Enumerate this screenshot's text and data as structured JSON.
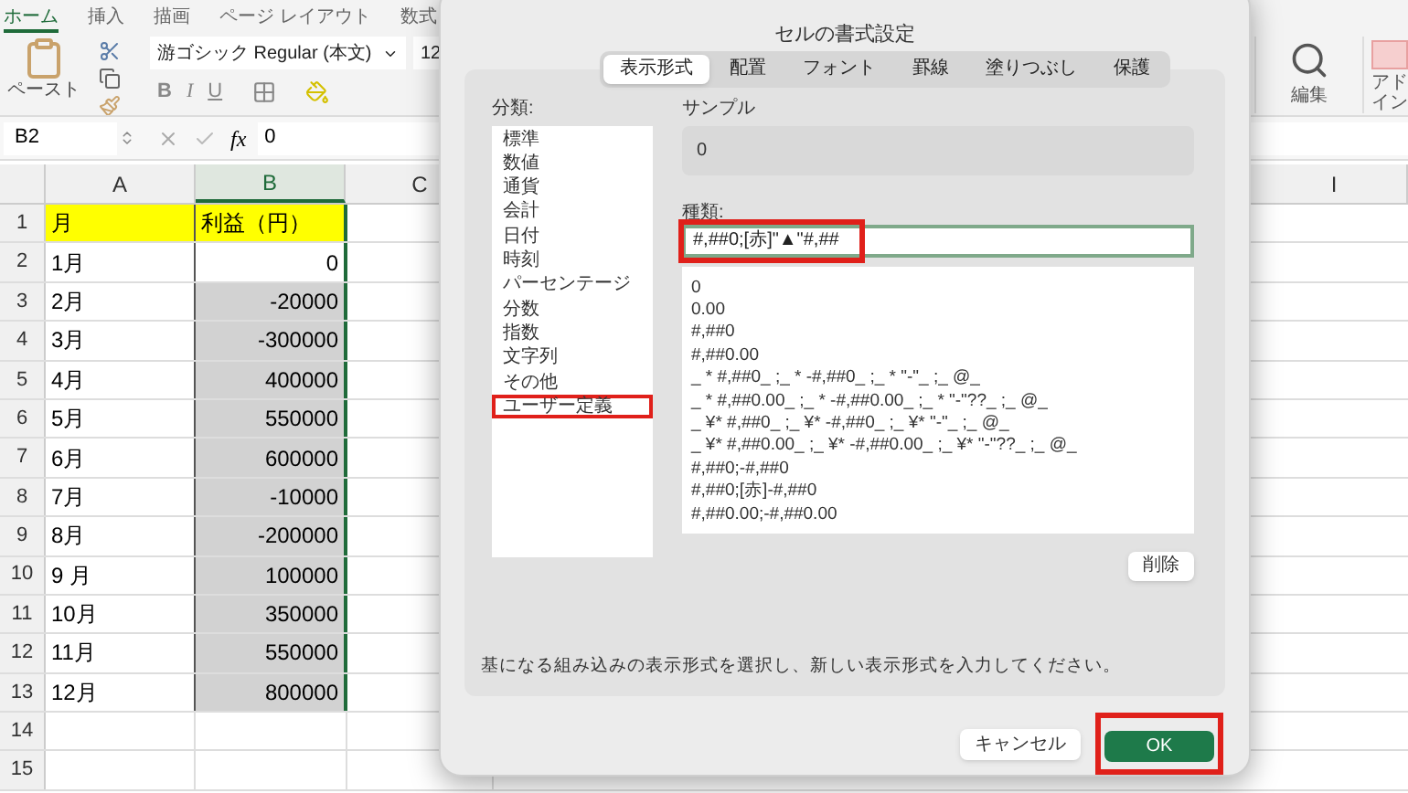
{
  "ribbon_tabs": [
    {
      "label": "ホーム",
      "selected": true
    },
    {
      "label": "挿入",
      "selected": false
    },
    {
      "label": "描画",
      "selected": false
    },
    {
      "label": "ページ レイアウト",
      "selected": false
    },
    {
      "label": "数式",
      "selected": false
    }
  ],
  "ribbon": {
    "paste_label": "ペースト",
    "font_name": "游ゴシック Regular (本文)",
    "font_size": "12",
    "bold": "B",
    "italic": "I",
    "underline": "U",
    "edit_label": "編集",
    "addin_label": "アドイン"
  },
  "formula_bar": {
    "cell_ref": "B2",
    "fx": "fx",
    "value": "0"
  },
  "sheet": {
    "columns": [
      "A",
      "B",
      "C",
      "I"
    ],
    "rows": [
      {
        "number": "1",
        "a": "月",
        "b": "利益（円）",
        "header": true
      },
      {
        "number": "2",
        "a": "1月",
        "b": "0",
        "header": false,
        "shaded": false
      },
      {
        "number": "3",
        "a": "2月",
        "b": "-20000",
        "header": false,
        "shaded": true
      },
      {
        "number": "4",
        "a": "3月",
        "b": "-300000",
        "header": false,
        "shaded": true
      },
      {
        "number": "5",
        "a": "4月",
        "b": "400000",
        "header": false,
        "shaded": true
      },
      {
        "number": "6",
        "a": "5月",
        "b": "550000",
        "header": false,
        "shaded": true
      },
      {
        "number": "7",
        "a": "6月",
        "b": "600000",
        "header": false,
        "shaded": true
      },
      {
        "number": "8",
        "a": "7月",
        "b": "-10000",
        "header": false,
        "shaded": true
      },
      {
        "number": "9",
        "a": "8月",
        "b": "-200000",
        "header": false,
        "shaded": true
      },
      {
        "number": "10",
        "a": "9 月",
        "b": "100000",
        "header": false,
        "shaded": true
      },
      {
        "number": "11",
        "a": "10月",
        "b": "350000",
        "header": false,
        "shaded": true
      },
      {
        "number": "12",
        "a": "11月",
        "b": "550000",
        "header": false,
        "shaded": true
      },
      {
        "number": "13",
        "a": "12月",
        "b": "800000",
        "header": false,
        "shaded": true
      },
      {
        "number": "14"
      },
      {
        "number": "15"
      }
    ]
  },
  "dialog": {
    "title": "セルの書式設定",
    "tabs": [
      {
        "label": "表示形式",
        "selected": true
      },
      {
        "label": "配置",
        "selected": false
      },
      {
        "label": "フォント",
        "selected": false
      },
      {
        "label": "罫線",
        "selected": false
      },
      {
        "label": "塗りつぶし",
        "selected": false
      },
      {
        "label": "保護",
        "selected": false
      }
    ],
    "category_label": "分類:",
    "categories": [
      {
        "label": "標準",
        "selected": false
      },
      {
        "label": "数値",
        "selected": false
      },
      {
        "label": "通貨",
        "selected": false
      },
      {
        "label": "会計",
        "selected": false
      },
      {
        "label": "日付",
        "selected": false
      },
      {
        "label": "時刻",
        "selected": false
      },
      {
        "label": "パーセンテージ",
        "selected": false
      },
      {
        "label": "分数",
        "selected": false
      },
      {
        "label": "指数",
        "selected": false
      },
      {
        "label": "文字列",
        "selected": false
      },
      {
        "label": "その他",
        "selected": false
      },
      {
        "label": "ユーザー定義",
        "selected": true
      }
    ],
    "sample_label": "サンプル",
    "sample_value": "0",
    "type_label": "種類:",
    "type_value": "#,##0;[赤]\"▲\"#,##",
    "type_highlighted": true,
    "formats": [
      "0",
      "0.00",
      "#,##0",
      "#,##0.00",
      "_ * #,##0_ ;_ * -#,##0_ ;_ * \"-\"_ ;_ @_",
      "_ * #,##0.00_ ;_ * -#,##0.00_ ;_ * \"-\"??_ ;_ @_",
      "_ ¥* #,##0_ ;_ ¥* -#,##0_ ;_ ¥* \"-\"_ ;_ @_",
      "_ ¥* #,##0.00_ ;_ ¥* -#,##0.00_ ;_ ¥* \"-\"??_ ;_ @_",
      "#,##0;-#,##0",
      "#,##0;[赤]-#,##0",
      "#,##0.00;-#,##0.00"
    ],
    "delete_button": "削除",
    "hint": "基になる組み込みの表示形式を選択し、新しい表示形式を入力してください。",
    "cancel_button": "キャンセル",
    "ok_button": "OK",
    "ok_highlighted": true
  }
}
